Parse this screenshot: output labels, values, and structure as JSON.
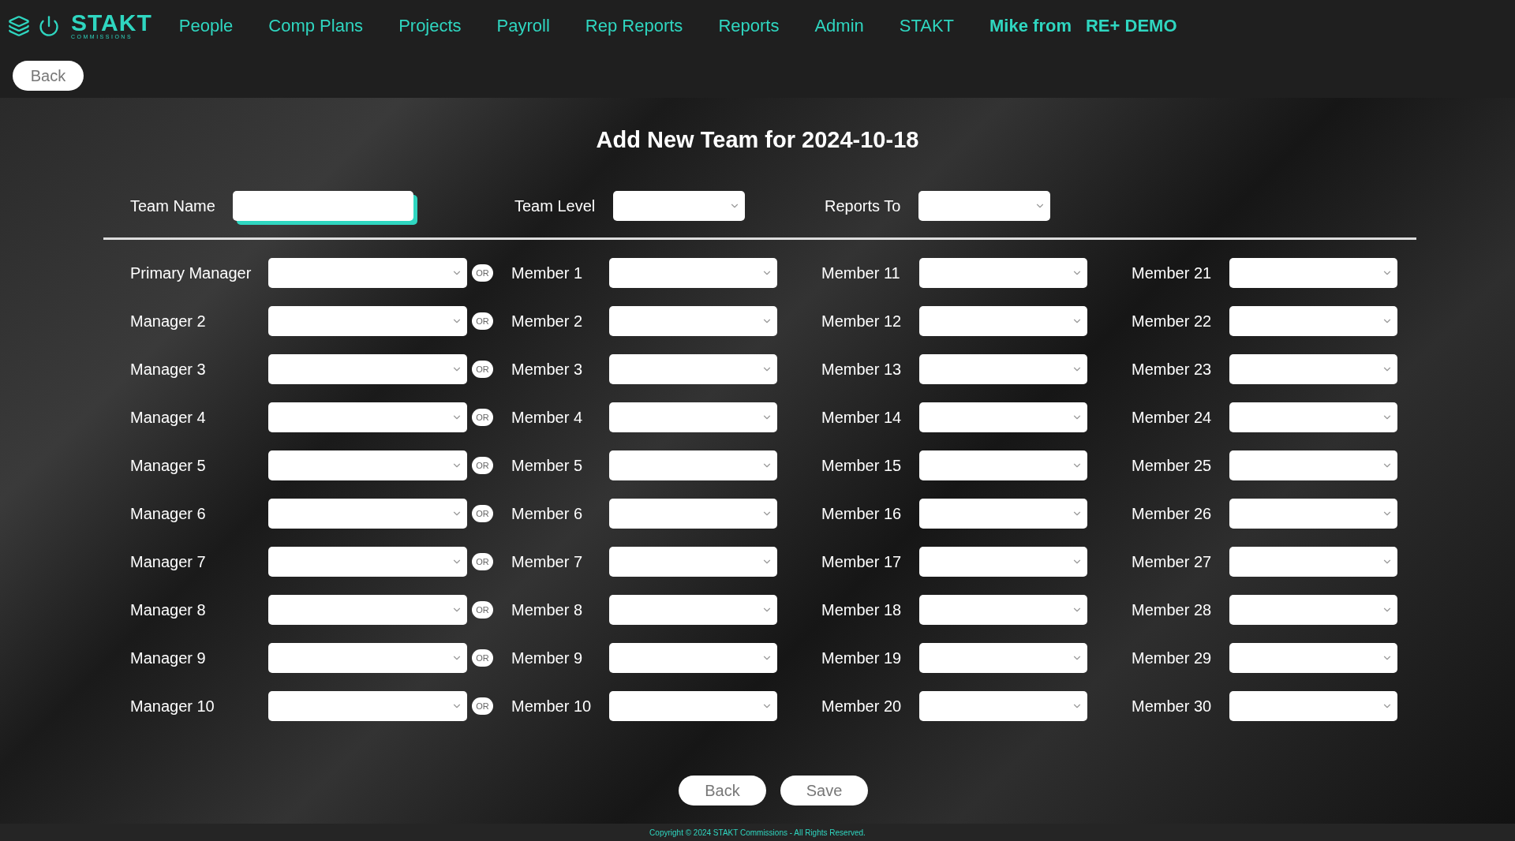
{
  "logo": {
    "name": "STAKT",
    "subtitle": "COMMISSIONS"
  },
  "nav": [
    "People",
    "Comp Plans",
    "Projects",
    "Payroll",
    "Rep Reports",
    "Reports",
    "Admin",
    "STAKT"
  ],
  "user": {
    "name": "Mike from",
    "org": "RE+ DEMO"
  },
  "top_back": "Back",
  "title": "Add New Team for 2024-10-18",
  "team_fields": [
    {
      "label": "Team Name",
      "kind": "text"
    },
    {
      "label": "Team Level",
      "kind": "select"
    },
    {
      "label": "Reports To",
      "kind": "select"
    }
  ],
  "rows": [
    {
      "manager": "Primary Manager",
      "separator": "OR",
      "members": [
        "Member 1",
        "Member 11",
        "Member 21"
      ]
    },
    {
      "manager": "Manager 2",
      "separator": "OR",
      "members": [
        "Member 2",
        "Member 12",
        "Member 22"
      ]
    },
    {
      "manager": "Manager 3",
      "separator": "OR",
      "members": [
        "Member 3",
        "Member 13",
        "Member 23"
      ]
    },
    {
      "manager": "Manager 4",
      "separator": "OR",
      "members": [
        "Member 4",
        "Member 14",
        "Member 24"
      ]
    },
    {
      "manager": "Manager 5",
      "separator": "OR",
      "members": [
        "Member 5",
        "Member 15",
        "Member 25"
      ]
    },
    {
      "manager": "Manager 6",
      "separator": "OR",
      "members": [
        "Member 6",
        "Member 16",
        "Member 26"
      ]
    },
    {
      "manager": "Manager 7",
      "separator": "OR",
      "members": [
        "Member 7",
        "Member 17",
        "Member 27"
      ]
    },
    {
      "manager": "Manager 8",
      "separator": "OR",
      "members": [
        "Member 8",
        "Member 18",
        "Member 28"
      ]
    },
    {
      "manager": "Manager 9",
      "separator": "OR",
      "members": [
        "Member 9",
        "Member 19",
        "Member 29"
      ]
    },
    {
      "manager": "Manager 10",
      "separator": "OR",
      "members": [
        "Member 10",
        "Member 20",
        "Member 30"
      ]
    }
  ],
  "buttons": [
    "Back",
    "Save"
  ],
  "footer": "Copyright © 2024 STAKT Commissions - All Rights Reserved."
}
